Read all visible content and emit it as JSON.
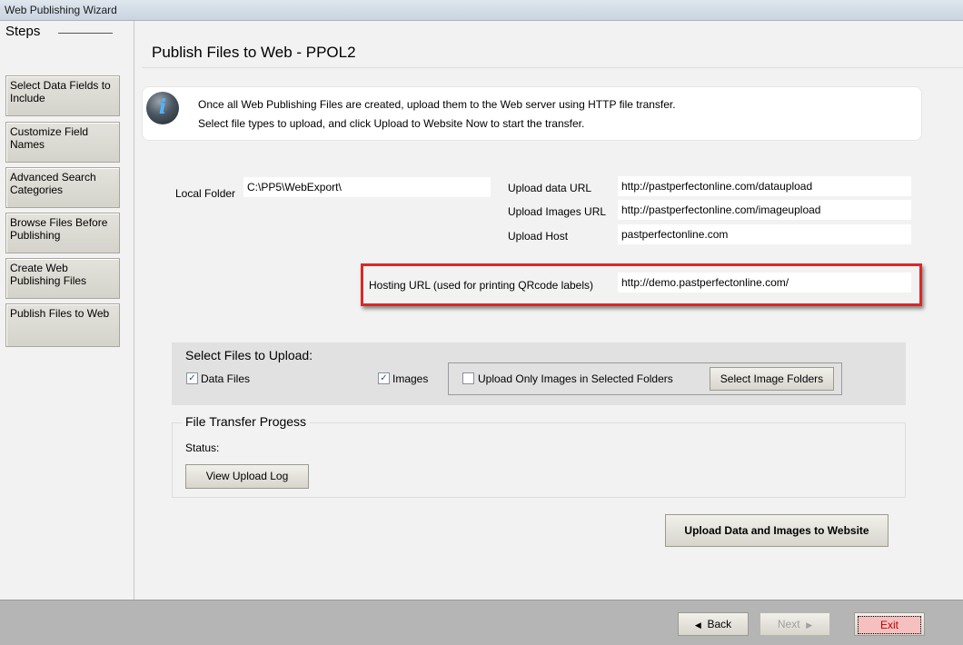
{
  "window": {
    "title": "Web Publishing Wizard"
  },
  "steps": {
    "header": "Steps",
    "items": [
      {
        "label": "Select Data Fields to Include"
      },
      {
        "label": "Customize Field Names"
      },
      {
        "label": "Advanced Search Categories"
      },
      {
        "label": "Browse Files Before Publishing"
      },
      {
        "label": "Create Web Publishing Files"
      },
      {
        "label": "Publish Files to Web"
      }
    ]
  },
  "main": {
    "title": "Publish Files to Web - PPOL2",
    "info_line1": "Once all Web Publishing Files are created, upload them to the Web server using HTTP file transfer.",
    "info_line2": "Select file types to upload, and click Upload to Website Now to start the transfer.",
    "info_icon": "info-icon"
  },
  "settings": {
    "local_folder_label": "Local Folder",
    "local_folder_value": "C:\\PP5\\WebExport\\",
    "upload_data_url_label": "Upload data URL",
    "upload_data_url_value": "http://pastperfectonline.com/dataupload",
    "upload_images_url_label": "Upload Images URL",
    "upload_images_url_value": "http://pastperfectonline.com/imageupload",
    "upload_host_label": "Upload Host",
    "upload_host_value": "pastperfectonline.com",
    "hosting_url_label": "Hosting URL (used for printing QRcode labels)",
    "hosting_url_value": "http://demo.pastperfectonline.com/"
  },
  "upload": {
    "title": "Select Files to Upload:",
    "data_files_label": "Data Files",
    "data_files_checked": true,
    "images_label": "Images",
    "images_checked": true,
    "only_selected_label": "Upload Only Images in Selected Folders",
    "only_selected_checked": false,
    "select_folders_button": "Select Image Folders"
  },
  "progress": {
    "title": "File Transfer Progess",
    "status_label": "Status:",
    "view_log_button": "View Upload Log"
  },
  "actions": {
    "upload_button": "Upload Data and Images to Website",
    "back_button": "Back",
    "next_button": "Next",
    "exit_button": "Exit"
  },
  "colors": {
    "highlight_border": "#d52a2a",
    "exit_text": "#c00000"
  }
}
